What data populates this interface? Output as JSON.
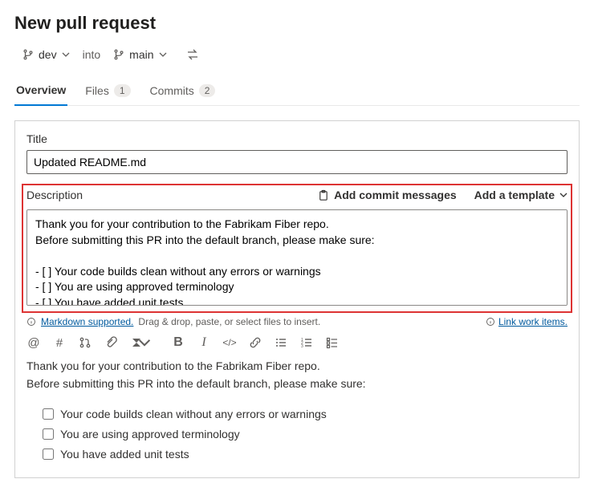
{
  "header": {
    "title": "New pull request"
  },
  "branches": {
    "source": "dev",
    "into_label": "into",
    "target": "main"
  },
  "tabs": {
    "overview": "Overview",
    "files": "Files",
    "files_count": "1",
    "commits": "Commits",
    "commits_count": "2"
  },
  "title_field": {
    "label": "Title",
    "value": "Updated README.md"
  },
  "description": {
    "label": "Description",
    "add_commit_msgs": "Add commit messages",
    "add_template": "Add a template",
    "text": "Thank you for your contribution to the Fabrikam Fiber repo.\nBefore submitting this PR into the default branch, please make sure:\n\n- [ ] Your code builds clean without any errors or warnings\n- [ ] You are using approved terminology\n- [ ] You have added unit tests"
  },
  "helper": {
    "markdown": "Markdown supported.",
    "drag": "Drag & drop, paste, or select files to insert.",
    "link_work": "Link work items."
  },
  "preview": {
    "line1": "Thank you for your contribution to the Fabrikam Fiber repo.",
    "line2": "Before submitting this PR into the default branch, please make sure:",
    "check1": "Your code builds clean without any errors or warnings",
    "check2": "You are using approved terminology",
    "check3": "You have added unit tests"
  }
}
